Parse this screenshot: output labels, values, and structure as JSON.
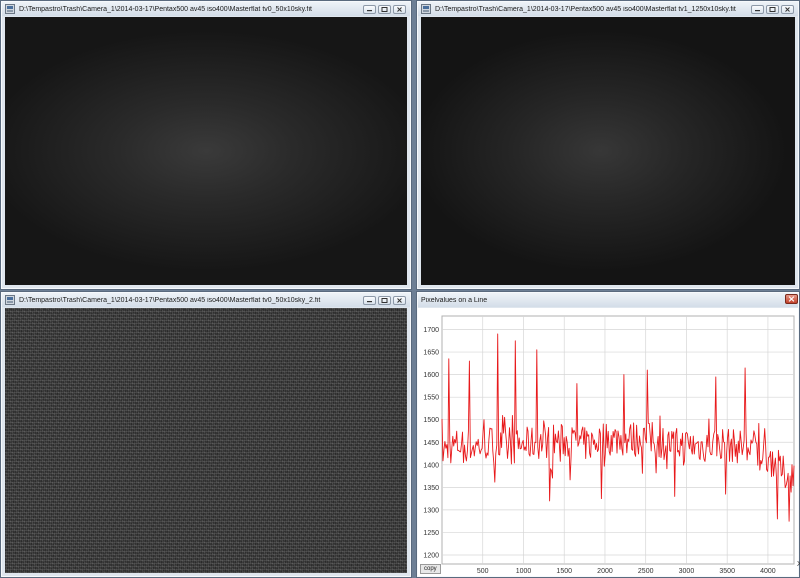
{
  "windows": [
    {
      "title": "D:\\Tempastro\\Trash\\Camera_1\\2014-03-17\\Pentax500 av45 iso400\\Masterflat tv0_50x10sky.fit"
    },
    {
      "title": "D:\\Tempastro\\Trash\\Camera_1\\2014-03-17\\Pentax500 av45 iso400\\Masterflat tv1_1250x10sky.fit"
    },
    {
      "title": "D:\\Tempastro\\Trash\\Camera_1\\2014-03-17\\Pentax500 av45 iso400\\Masterflat tv0_50x10sky_2.fit"
    }
  ],
  "plot_window": {
    "title": "Pixelvalues on a Line",
    "copy_label": "copy"
  },
  "colors": {
    "line": "#e8191b",
    "grid": "#d6d6d6",
    "titlebar": "#dfe6ee"
  },
  "icons": [
    "app-icon",
    "minimize-icon",
    "maximize-icon",
    "close-icon"
  ],
  "chart_data": {
    "type": "line",
    "title": "",
    "xlabel": "X",
    "ylabel": "",
    "xlim": [
      0,
      4320
    ],
    "ylim": [
      1180,
      1730
    ],
    "x_ticks": [
      500,
      1000,
      1500,
      2000,
      2500,
      3000,
      3500,
      4000
    ],
    "y_ticks": [
      1200,
      1250,
      1300,
      1350,
      1400,
      1450,
      1500,
      1550,
      1600,
      1650,
      1700
    ],
    "grid": true,
    "series": [
      {
        "x": [
          0,
          200,
          400,
          600,
          800,
          1000,
          1200,
          1400,
          1600,
          1800,
          2000,
          2200,
          2400,
          2600,
          2800,
          3000,
          3200,
          3400,
          3600,
          3800,
          4000,
          4200,
          4320
        ],
        "values": [
          1430,
          1445,
          1440,
          1450,
          1435,
          1445,
          1450,
          1455,
          1450,
          1445,
          1460,
          1455,
          1460,
          1455,
          1445,
          1445,
          1440,
          1450,
          1440,
          1445,
          1420,
          1380,
          1375
        ],
        "spikes": [
          {
            "x": 80,
            "y": 1635
          },
          {
            "x": 330,
            "y": 1630
          },
          {
            "x": 680,
            "y": 1690
          },
          {
            "x": 900,
            "y": 1675
          },
          {
            "x": 1160,
            "y": 1655
          },
          {
            "x": 1660,
            "y": 1580
          },
          {
            "x": 2230,
            "y": 1600
          },
          {
            "x": 2520,
            "y": 1610
          },
          {
            "x": 3360,
            "y": 1595
          },
          {
            "x": 3720,
            "y": 1615
          },
          {
            "x": 1320,
            "y": 1320
          },
          {
            "x": 1960,
            "y": 1325
          },
          {
            "x": 2850,
            "y": 1330
          },
          {
            "x": 3480,
            "y": 1335
          },
          {
            "x": 4110,
            "y": 1280
          },
          {
            "x": 4260,
            "y": 1275
          }
        ]
      }
    ]
  }
}
